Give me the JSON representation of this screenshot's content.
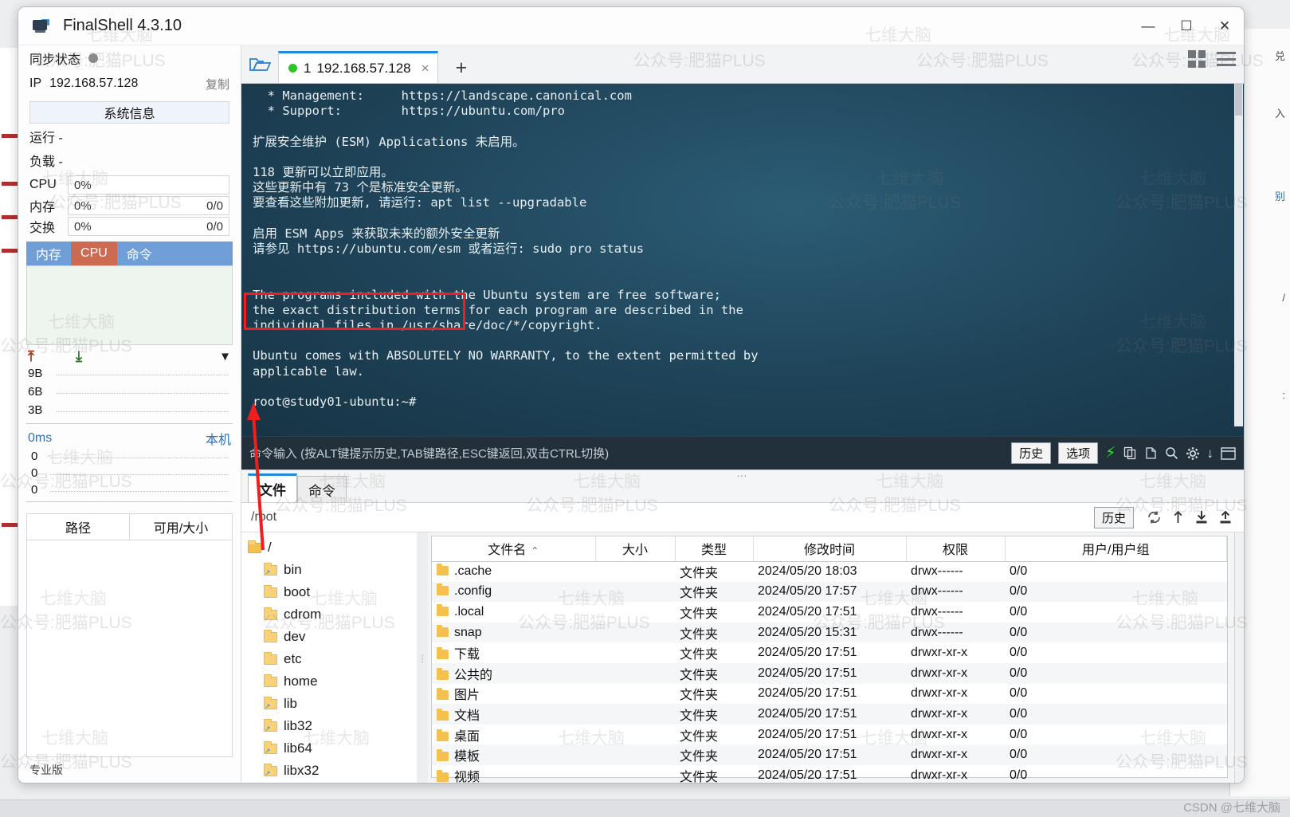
{
  "window": {
    "title": "FinalShell 4.3.10",
    "icon": "app-icon",
    "minimize": "—",
    "maximize": "☐",
    "close": "✕"
  },
  "sidebar": {
    "sync_label": "同步状态",
    "ip_label": "IP",
    "ip_value": "192.168.57.128",
    "copy_label": "复制",
    "sysinfo_button": "系统信息",
    "uptime": "运行 -",
    "load": "负载 -",
    "gauges": [
      {
        "label": "CPU",
        "pct": "0%",
        "right": ""
      },
      {
        "label": "内存",
        "pct": "0%",
        "right": "0/0"
      },
      {
        "label": "交换",
        "pct": "0%",
        "right": "0/0"
      }
    ],
    "mini_tabs": [
      {
        "label": "内存",
        "active": false
      },
      {
        "label": "CPU",
        "active": true
      },
      {
        "label": "命令",
        "active": false
      }
    ],
    "net_y_labels": [
      "9B",
      "6B",
      "3B"
    ],
    "ping_value": "0ms",
    "ping_host": "本机",
    "ping_y_labels": [
      "0",
      "0",
      "0"
    ],
    "disk_headers": [
      "路径",
      "可用/大小"
    ],
    "edition": "专业版"
  },
  "terminal": {
    "folder_icon": "open-folder-icon",
    "tab": {
      "status_dot": "●",
      "index": "1",
      "label": "192.168.57.128",
      "close": "×"
    },
    "new_tab": "+",
    "grid_icon": "grid-view-icon",
    "menu_icon": "hamburger-menu-icon",
    "content": "  * Management:     https://landscape.canonical.com\n  * Support:        https://ubuntu.com/pro\n\n扩展安全维护 (ESM) Applications 未启用。\n\n118 更新可以立即应用。\n这些更新中有 73 个是标准安全更新。\n要查看这些附加更新, 请运行: apt list --upgradable\n\n启用 ESM Apps 来获取未来的额外安全更新\n请参见 https://ubuntu.com/esm 或者运行: sudo pro status\n\n\nThe programs included with the Ubuntu system are free software;\nthe exact distribution terms for each program are described in the\nindividual files in /usr/share/doc/*/copyright.\n\nUbuntu comes with ABSOLUTELY NO WARRANTY, to the extent permitted by\napplicable law.\n\nroot@study01-ubuntu:~# ",
    "prompt": "root@study01-ubuntu:~#"
  },
  "command_bar": {
    "placeholder": "命令输入 (按ALT键提示历史,TAB键路径,ESC键返回,双击CTRL切换)",
    "history_button": "历史",
    "options_button": "选项",
    "icons": [
      "lightning-icon",
      "copy-icon",
      "paste-icon",
      "search-icon",
      "gear-icon",
      "download-icon",
      "window-icon"
    ]
  },
  "file_manager": {
    "tabs": [
      {
        "label": "文件",
        "active": true
      },
      {
        "label": "命令",
        "active": false
      }
    ],
    "path": "/root",
    "history_button": "历史",
    "toolbar_icons": [
      "refresh-icon",
      "upload-arrow-icon",
      "download-icon",
      "upload-icon"
    ],
    "tree": [
      {
        "label": "/",
        "level": 0,
        "link": false
      },
      {
        "label": "bin",
        "level": 1,
        "link": true
      },
      {
        "label": "boot",
        "level": 1,
        "link": false
      },
      {
        "label": "cdrom",
        "level": 1,
        "link": false
      },
      {
        "label": "dev",
        "level": 1,
        "link": false
      },
      {
        "label": "etc",
        "level": 1,
        "link": false
      },
      {
        "label": "home",
        "level": 1,
        "link": false
      },
      {
        "label": "lib",
        "level": 1,
        "link": true
      },
      {
        "label": "lib32",
        "level": 1,
        "link": true
      },
      {
        "label": "lib64",
        "level": 1,
        "link": true
      },
      {
        "label": "libx32",
        "level": 1,
        "link": true
      }
    ],
    "columns": [
      "文件名",
      "大小",
      "类型",
      "修改时间",
      "权限",
      "用户/用户组"
    ],
    "sort_indicator": "⌃",
    "rows": [
      {
        "name": ".cache",
        "size": "",
        "type": "文件夹",
        "modified": "2024/05/20 18:03",
        "perm": "drwx------",
        "owner": "0/0"
      },
      {
        "name": ".config",
        "size": "",
        "type": "文件夹",
        "modified": "2024/05/20 17:57",
        "perm": "drwx------",
        "owner": "0/0"
      },
      {
        "name": ".local",
        "size": "",
        "type": "文件夹",
        "modified": "2024/05/20 17:51",
        "perm": "drwx------",
        "owner": "0/0"
      },
      {
        "name": "snap",
        "size": "",
        "type": "文件夹",
        "modified": "2024/05/20 15:31",
        "perm": "drwx------",
        "owner": "0/0"
      },
      {
        "name": "下载",
        "size": "",
        "type": "文件夹",
        "modified": "2024/05/20 17:51",
        "perm": "drwxr-xr-x",
        "owner": "0/0"
      },
      {
        "name": "公共的",
        "size": "",
        "type": "文件夹",
        "modified": "2024/05/20 17:51",
        "perm": "drwxr-xr-x",
        "owner": "0/0"
      },
      {
        "name": "图片",
        "size": "",
        "type": "文件夹",
        "modified": "2024/05/20 17:51",
        "perm": "drwxr-xr-x",
        "owner": "0/0"
      },
      {
        "name": "文档",
        "size": "",
        "type": "文件夹",
        "modified": "2024/05/20 17:51",
        "perm": "drwxr-xr-x",
        "owner": "0/0"
      },
      {
        "name": "桌面",
        "size": "",
        "type": "文件夹",
        "modified": "2024/05/20 17:51",
        "perm": "drwxr-xr-x",
        "owner": "0/0"
      },
      {
        "name": "模板",
        "size": "",
        "type": "文件夹",
        "modified": "2024/05/20 17:51",
        "perm": "drwxr-xr-x",
        "owner": "0/0"
      },
      {
        "name": "视频",
        "size": "",
        "type": "文件夹",
        "modified": "2024/05/20 17:51",
        "perm": "drwxr-xr-x",
        "owner": "0/0"
      }
    ]
  },
  "watermarks": {
    "line1": "七维大脑",
    "line2": "公众号:肥猫PLUS",
    "csdn": "CSDN @七维大脑"
  },
  "colors": {
    "accent": "#1e8ae0",
    "terminal_bg": "#1f4459",
    "annotation_red": "#f01f1f",
    "tab_blue": "#6f9fd6",
    "tab_red": "#cc6a52",
    "status_green": "#2ec428"
  }
}
